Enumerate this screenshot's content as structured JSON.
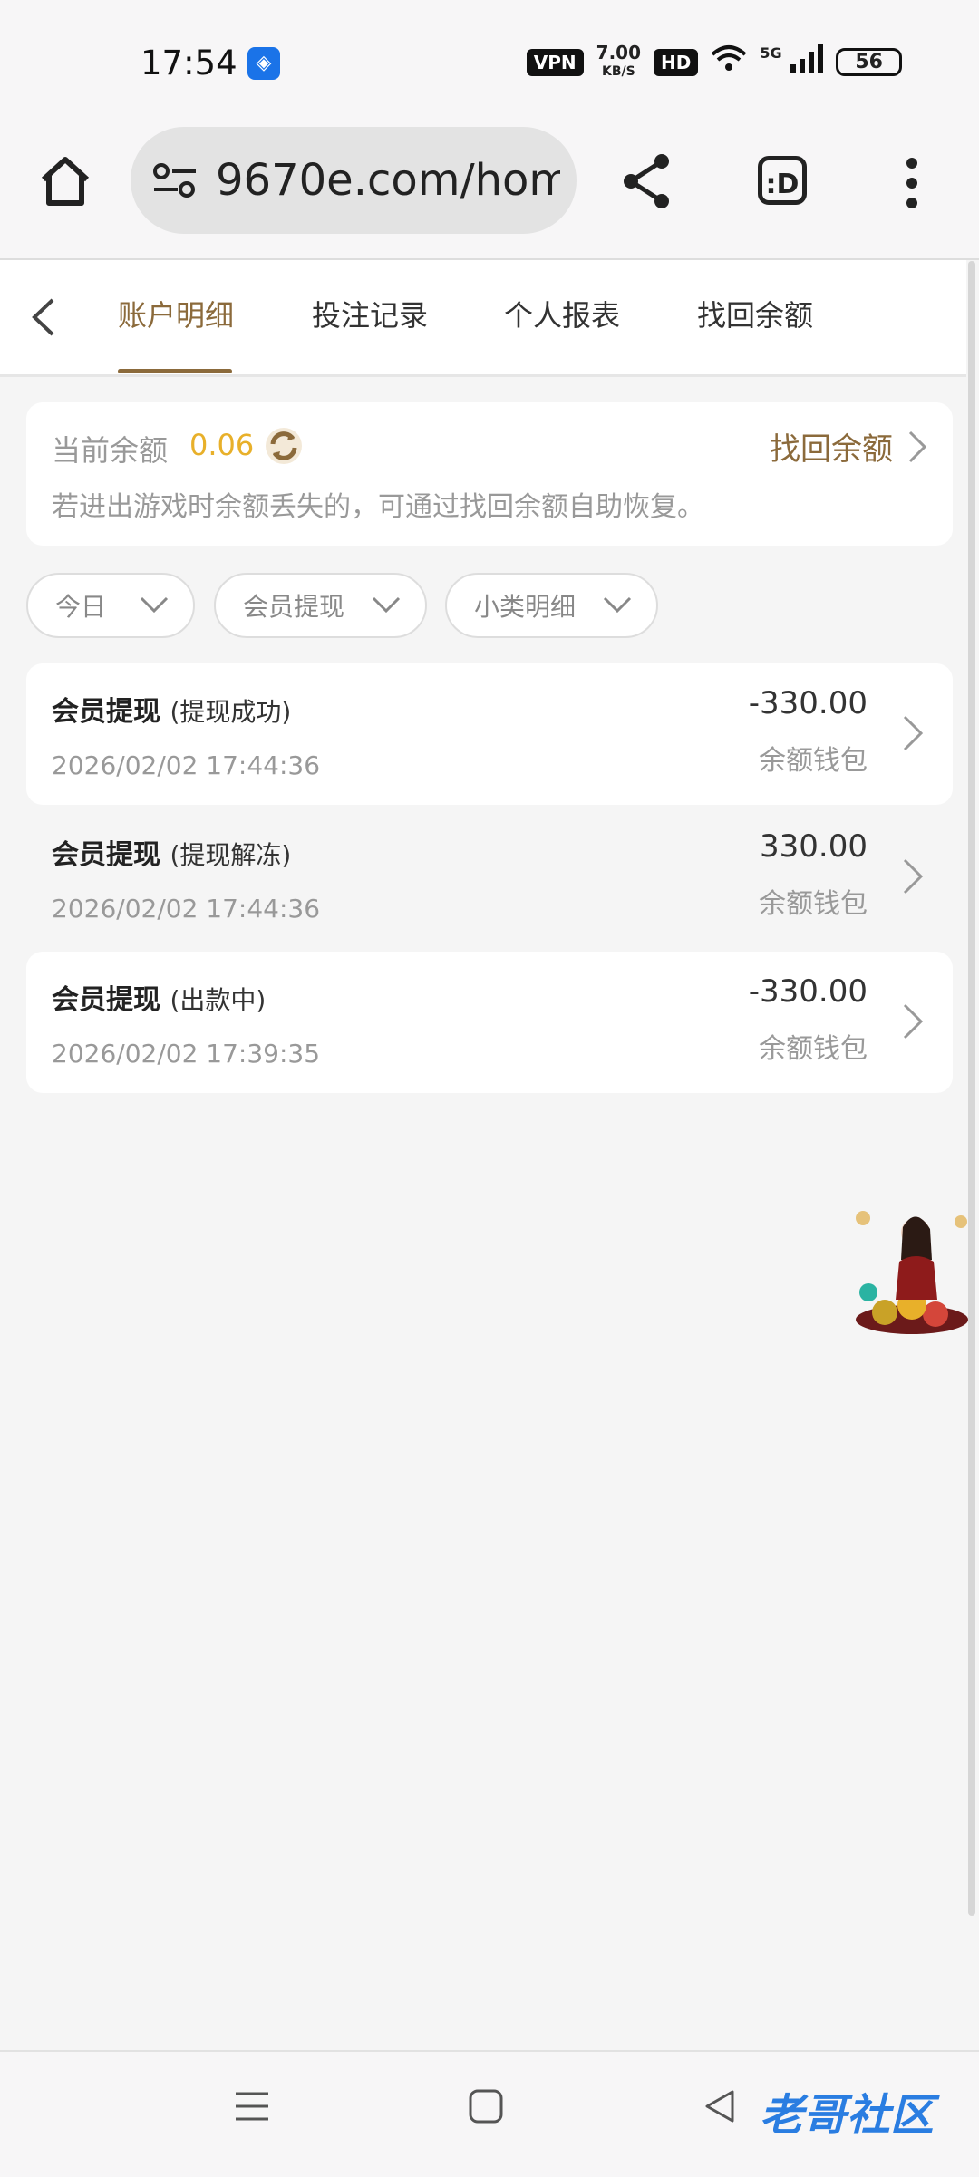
{
  "status_bar": {
    "time": "17:54",
    "vpn": "VPN",
    "speed_value": "7.00",
    "speed_unit": "KB/S",
    "hd": "HD",
    "network": "5G",
    "battery": "56"
  },
  "browser": {
    "url": "9670e.com/home",
    "tab_switcher": ":D"
  },
  "tabs": [
    {
      "label": "账户明细",
      "active": true
    },
    {
      "label": "投注记录",
      "active": false
    },
    {
      "label": "个人报表",
      "active": false
    },
    {
      "label": "找回余额",
      "active": false
    }
  ],
  "balance": {
    "label": "当前余额",
    "value": "0.06",
    "recover_label": "找回余额",
    "hint": "若进出游戏时余额丢失的，可通过找回余额自助恢复。"
  },
  "filters": [
    {
      "label": "今日"
    },
    {
      "label": "会员提现"
    },
    {
      "label": "小类明细"
    }
  ],
  "records": [
    {
      "title": "会员提现",
      "status": "(提现成功)",
      "date": "2026/02/02 17:44:36",
      "amount": "-330.00",
      "wallet": "余额钱包"
    },
    {
      "title": "会员提现",
      "status": "(提现解冻)",
      "date": "2026/02/02 17:44:36",
      "amount": "330.00",
      "wallet": "余额钱包"
    },
    {
      "title": "会员提现",
      "status": "(出款中)",
      "date": "2026/02/02 17:39:35",
      "amount": "-330.00",
      "wallet": "余额钱包"
    }
  ],
  "watermark": "老哥社区",
  "colors": {
    "accent": "#8b6a3b",
    "balance_value": "#e8b02a",
    "background": "#f5f5f5"
  }
}
